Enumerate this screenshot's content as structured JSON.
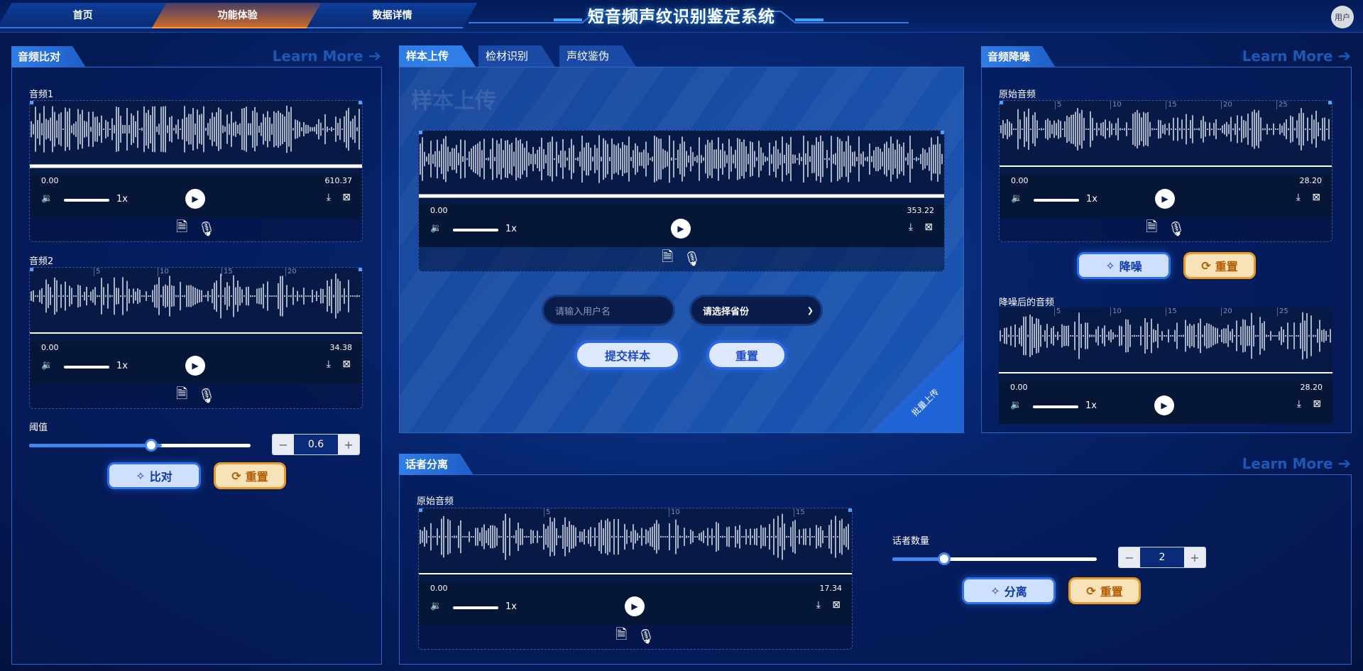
{
  "nav": {
    "tabs": [
      {
        "label": "首页"
      },
      {
        "label": "功能体验"
      },
      {
        "label": "数据详情"
      }
    ],
    "title": "短音频声纹识别鉴定系统",
    "user": "用户"
  },
  "compare": {
    "title": "音频比对",
    "learn_more": "Learn More",
    "audio1": {
      "label": "音频1",
      "start": "0.00",
      "end": "610.37",
      "rate": "1x"
    },
    "audio2": {
      "label": "音频2",
      "start": "0.00",
      "end": "34.38",
      "rate": "1x",
      "ticks": [
        "5",
        "10",
        "15",
        "20"
      ]
    },
    "threshold_label": "阈值",
    "threshold_value": "0.6",
    "threshold_level": 0.6,
    "btn_compare": "比对",
    "btn_reset": "重置"
  },
  "upload": {
    "tabs": [
      {
        "label": "样本上传"
      },
      {
        "label": "检材识别"
      },
      {
        "label": "声纹鉴伪"
      }
    ],
    "watermark": "样本上传",
    "player": {
      "start": "0.00",
      "end": "353.22",
      "rate": "1x"
    },
    "username_placeholder": "请输入用户名",
    "province_selected": "请选择省份",
    "btn_submit": "提交样本",
    "btn_reset": "重置",
    "batch": "批量上传"
  },
  "denoise": {
    "title": "音频降噪",
    "learn_more": "Learn More",
    "original": {
      "label": "原始音频",
      "start": "0.00",
      "end": "28.20",
      "rate": "1x",
      "ticks": [
        "5",
        "10",
        "15",
        "20",
        "25"
      ]
    },
    "btn_denoise": "降噪",
    "btn_reset": "重置",
    "denoised": {
      "label": "降噪后的音频",
      "start": "0.00",
      "end": "28.20",
      "rate": "1x",
      "ticks": [
        "5",
        "10",
        "15",
        "20",
        "25"
      ]
    }
  },
  "diarization": {
    "title": "话者分离",
    "learn_more": "Learn More",
    "original": {
      "label": "原始音频",
      "start": "0.00",
      "end": "17.34",
      "rate": "1x",
      "ticks": [
        "5",
        "10",
        "15"
      ]
    },
    "speaker_count_label": "话者数量",
    "speaker_count": "2",
    "speaker_level": 0.2,
    "btn_separate": "分离",
    "btn_reset": "重置"
  },
  "colors": {
    "accent": "#2f7ee8",
    "orange": "#e79a25",
    "panel_border": "#2e67c4"
  },
  "icons": [
    "volume-icon",
    "play-icon",
    "download-icon",
    "mic-icon",
    "music-file-icon",
    "sparkle-icon",
    "refresh-icon",
    "arrow-right-icon"
  ]
}
